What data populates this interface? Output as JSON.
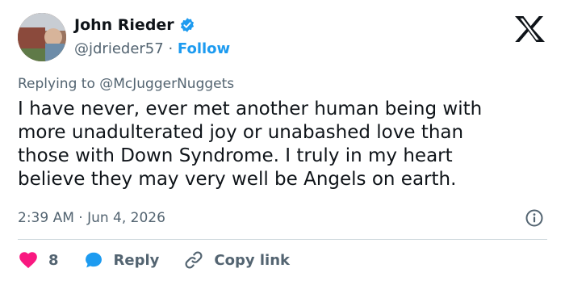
{
  "author": {
    "display_name": "John Rieder",
    "handle": "@jdrieder57",
    "separator": " · ",
    "follow_label": "Follow"
  },
  "reply_context": {
    "prefix": "Replying to ",
    "mention": "@McJuggerNuggets"
  },
  "tweet": {
    "text": "I have never, ever met another human being with\nmore unadulterated joy or unabashed love than\nthose with Down Syndrome. I truly in my heart\nbelieve they may very well be Angels on earth.",
    "timestamp": "2:39 AM · Jun 4, 2026"
  },
  "actions": {
    "like_count": "8",
    "reply_label": "Reply",
    "copy_link_label": "Copy link"
  },
  "colors": {
    "accent": "#1d9bf0",
    "like": "#f91880",
    "muted": "#536471",
    "text": "#0f1419"
  },
  "icons": [
    "verified-badge-icon",
    "x-logo-icon",
    "info-icon",
    "heart-icon",
    "reply-bubble-icon",
    "link-icon"
  ]
}
